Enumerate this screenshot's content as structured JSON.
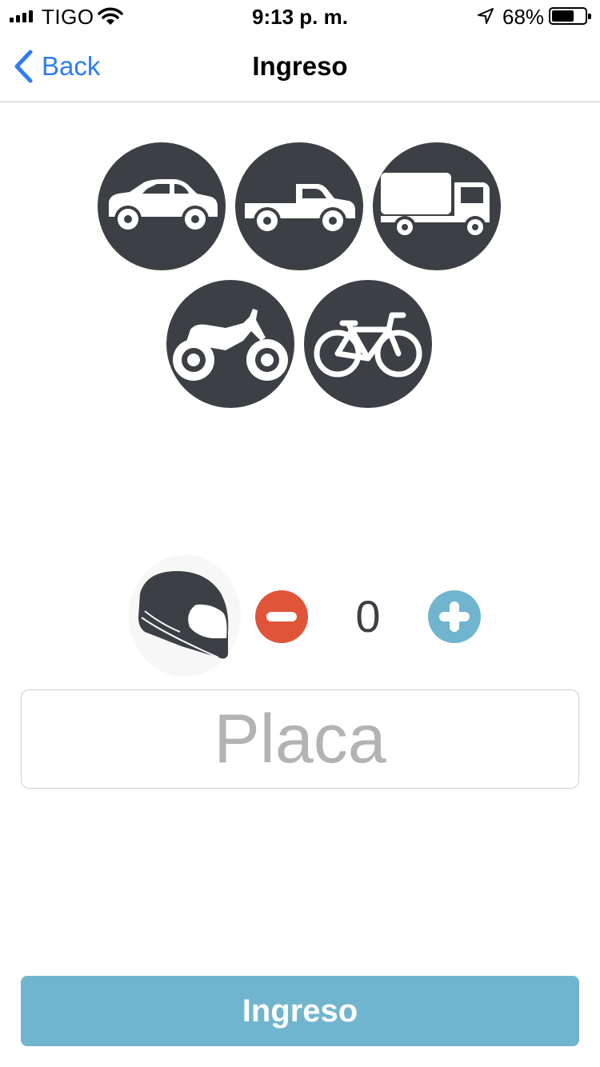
{
  "status_bar": {
    "carrier": "TIGO",
    "time": "9:13 p. m.",
    "battery_percent": "68%",
    "battery_level": 0.68,
    "icons": [
      "signal-icon",
      "wifi-icon",
      "location-arrow-icon",
      "battery-icon"
    ]
  },
  "nav": {
    "back_label": "Back",
    "title": "Ingreso"
  },
  "vehicles": [
    {
      "type": "car",
      "icon": "car-icon"
    },
    {
      "type": "pickup",
      "icon": "pickup-truck-icon"
    },
    {
      "type": "truck",
      "icon": "truck-icon"
    },
    {
      "type": "motorcycle",
      "icon": "motorcycle-icon"
    },
    {
      "type": "bicycle",
      "icon": "bicycle-icon"
    }
  ],
  "helmets": {
    "icon": "helmet-icon",
    "count": "0",
    "minus_icon": "minus-icon",
    "plus_icon": "plus-icon"
  },
  "plate": {
    "placeholder": "Placa",
    "value": ""
  },
  "submit": {
    "label": "Ingreso"
  },
  "colors": {
    "icon_circle": "#3c3f44",
    "minus": "#e0553a",
    "plus": "#70b5cd",
    "submit": "#70b5cd",
    "link": "#2f7cf6"
  }
}
